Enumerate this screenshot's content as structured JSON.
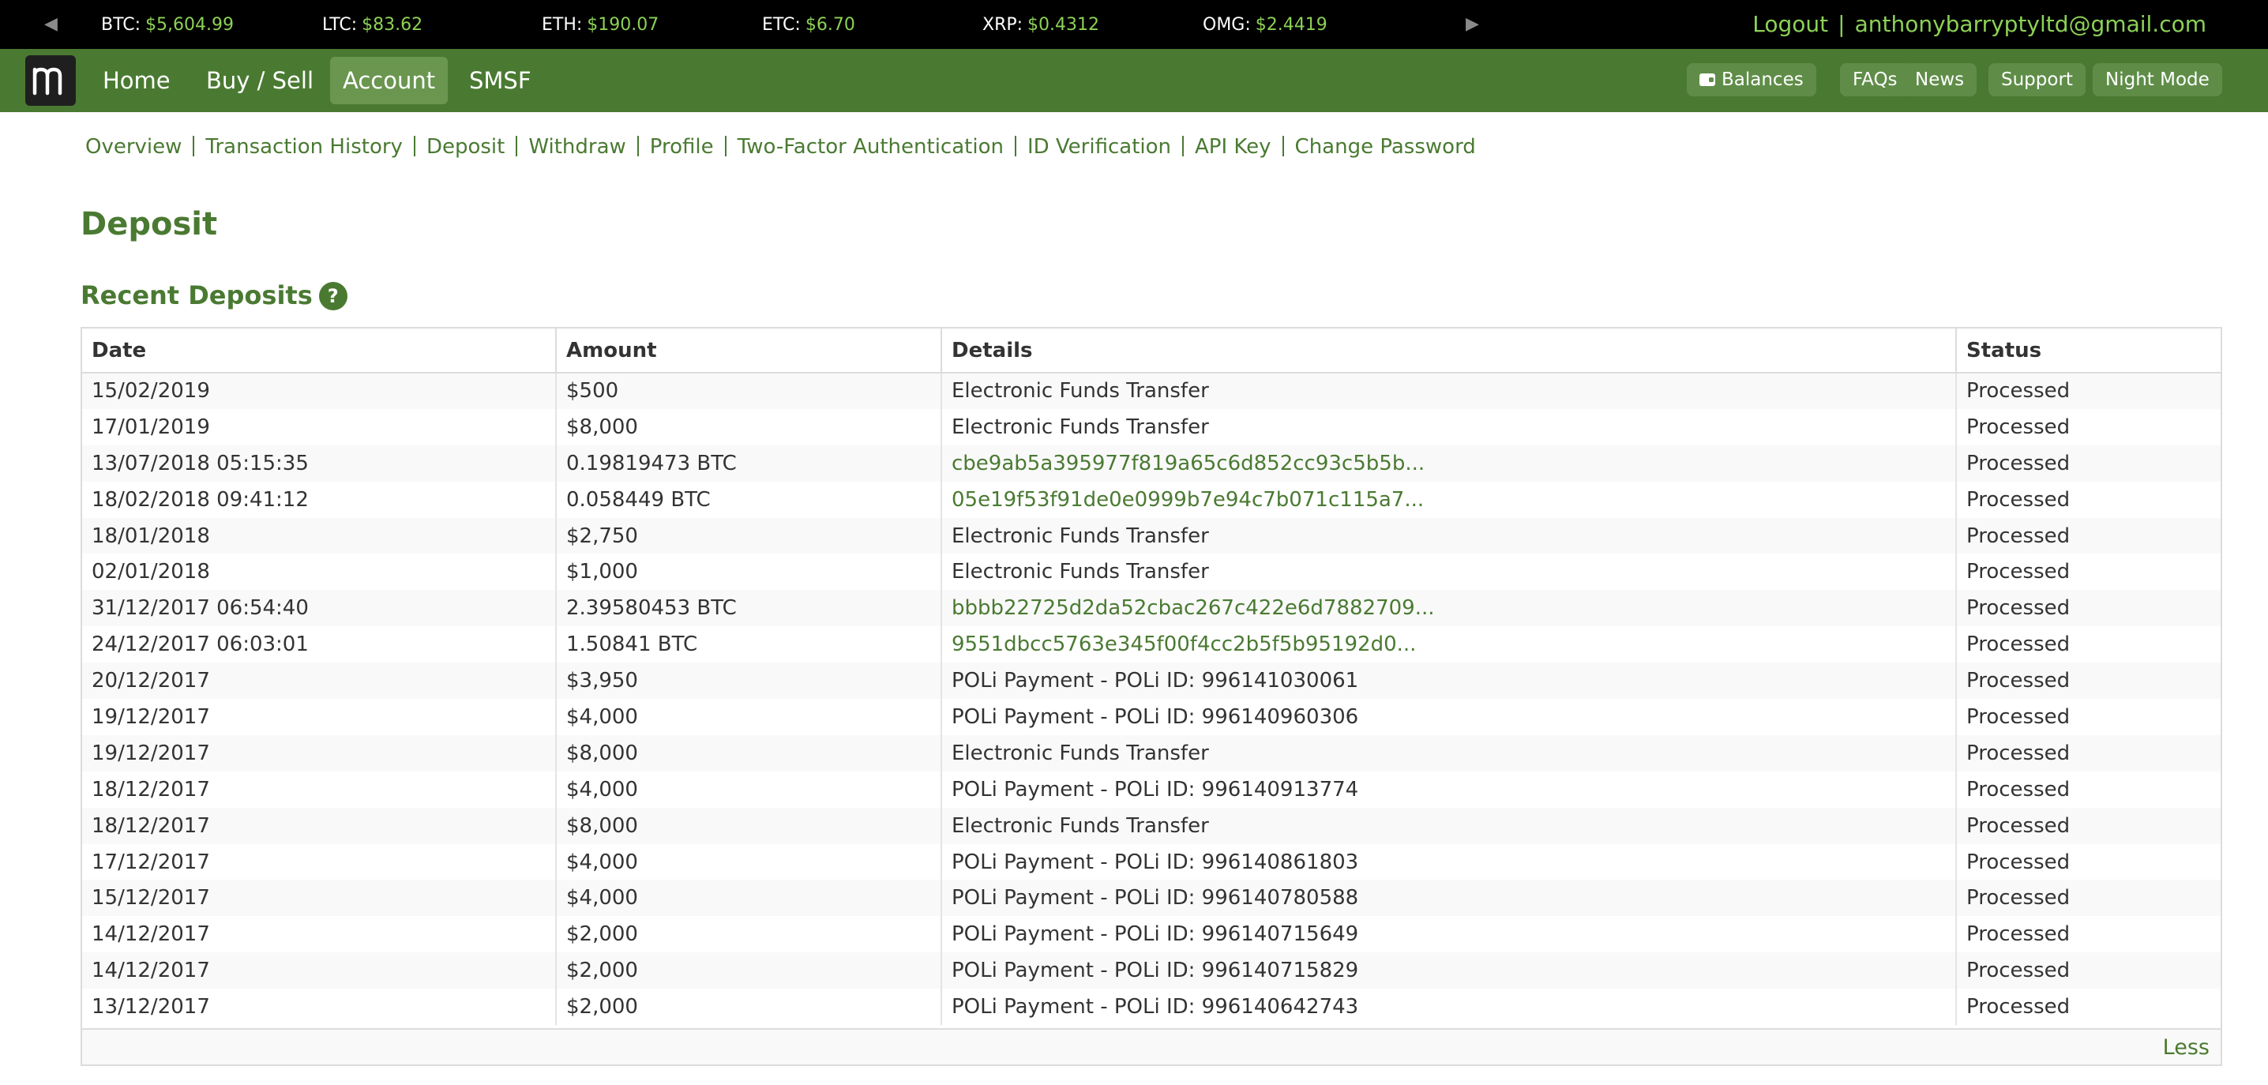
{
  "ticker": {
    "prices": [
      {
        "symbol": "BTC:",
        "value": "$5,604.99"
      },
      {
        "symbol": "LTC:",
        "value": "$83.62"
      },
      {
        "symbol": "ETH:",
        "value": "$190.07"
      },
      {
        "symbol": "ETC:",
        "value": "$6.70"
      },
      {
        "symbol": "XRP:",
        "value": "$0.4312"
      },
      {
        "symbol": "OMG:",
        "value": "$2.4419"
      }
    ],
    "logout": "Logout",
    "separator": "|",
    "email": "anthonybarryptyltd@gmail.com",
    "left_arrow": "◀",
    "right_arrow": "▶"
  },
  "nav": {
    "items": [
      "Home",
      "Buy / Sell",
      "Account",
      "SMSF"
    ],
    "active": "Account",
    "pills": [
      "Balances",
      "FAQs",
      "News",
      "Support",
      "Night Mode"
    ]
  },
  "subnav": {
    "items": [
      "Overview",
      "Transaction History",
      "Deposit",
      "Withdraw",
      "Profile",
      "Two-Factor Authentication",
      "ID Verification",
      "API Key",
      "Change Password"
    ]
  },
  "page": {
    "title": "Deposit",
    "section_title": "Recent Deposits",
    "help": "?"
  },
  "table": {
    "headers": [
      "Date",
      "Amount",
      "Details",
      "Status"
    ],
    "rows": [
      [
        "15/02/2019",
        "$500",
        "Electronic Funds Transfer",
        "Processed"
      ],
      [
        "17/01/2019",
        "$8,000",
        "Electronic Funds Transfer",
        "Processed"
      ],
      [
        "13/07/2018 05:15:35",
        "0.19819473 BTC",
        "cbe9ab5a395977f819a65c6d852cc93c5b5b...",
        "Processed"
      ],
      [
        "18/02/2018 09:41:12",
        "0.058449 BTC",
        "05e19f53f91de0e0999b7e94c7b071c115a7...",
        "Processed"
      ],
      [
        "18/01/2018",
        "$2,750",
        "Electronic Funds Transfer",
        "Processed"
      ],
      [
        "02/01/2018",
        "$1,000",
        "Electronic Funds Transfer",
        "Processed"
      ],
      [
        "31/12/2017 06:54:40",
        "2.39580453 BTC",
        "bbbb22725d2da52cbac267c422e6d7882709...",
        "Processed"
      ],
      [
        "24/12/2017 06:03:01",
        "1.50841 BTC",
        "9551dbcc5763e345f00f4cc2b5f5b95192d0...",
        "Processed"
      ],
      [
        "20/12/2017",
        "$3,950",
        "POLi Payment - POLi ID: 996141030061",
        "Processed"
      ],
      [
        "19/12/2017",
        "$4,000",
        "POLi Payment - POLi ID: 996140960306",
        "Processed"
      ],
      [
        "19/12/2017",
        "$8,000",
        "Electronic Funds Transfer",
        "Processed"
      ],
      [
        "18/12/2017",
        "$4,000",
        "POLi Payment - POLi ID: 996140913774",
        "Processed"
      ],
      [
        "18/12/2017",
        "$8,000",
        "Electronic Funds Transfer",
        "Processed"
      ],
      [
        "17/12/2017",
        "$4,000",
        "POLi Payment - POLi ID: 996140861803",
        "Processed"
      ],
      [
        "15/12/2017",
        "$4,000",
        "POLi Payment - POLi ID: 996140780588",
        "Processed"
      ],
      [
        "14/12/2017",
        "$2,000",
        "POLi Payment - POLi ID: 996140715649",
        "Processed"
      ],
      [
        "14/12/2017",
        "$2,000",
        "POLi Payment - POLi ID: 996140715829",
        "Processed"
      ],
      [
        "13/12/2017",
        "$2,000",
        "POLi Payment - POLi ID: 996140642743",
        "Processed"
      ]
    ],
    "hash_rows": [
      2,
      3,
      6,
      7
    ],
    "less_label": "Less"
  },
  "colors": {
    "brand_green": "#4a7a32",
    "price_green": "#8cd156",
    "ticker_bg": "#000000"
  },
  "icons": [
    "left-arrow-icon",
    "right-arrow-icon",
    "logo-m-icon",
    "wallet-icon",
    "help-icon"
  ]
}
